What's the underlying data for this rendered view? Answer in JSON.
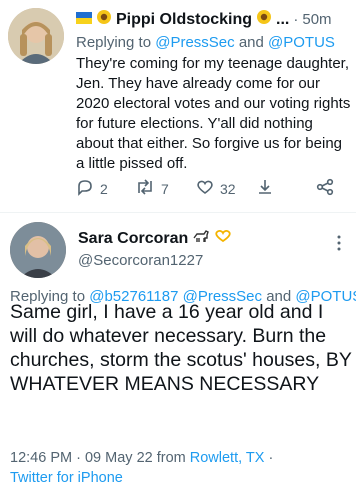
{
  "tweet1": {
    "display_name": "Pippi Oldstocking",
    "truncation": "...",
    "separator": "·",
    "time": "50m",
    "replying_prefix": "Replying to",
    "replying_handles": [
      "@PressSec",
      "@POTUS"
    ],
    "replying_joiner": "and",
    "body": "They're coming for my teenage daughter, Jen. They have already come for our 2020 electoral votes and our voting rights for future elections. Y'all did nothing about that either. So forgive us for being a little pissed off.",
    "replies": "2",
    "retweets": "7",
    "likes": "32",
    "icons": [
      "flag-icon",
      "sunflower-icon",
      "reply-icon",
      "retweet-icon",
      "like-icon",
      "share-icon",
      "more-icon"
    ]
  },
  "tweet2": {
    "display_name": "Sara Corcoran",
    "handle": "@Secorcoran1227",
    "replying_prefix": "Replying to",
    "replying_handles": [
      "@b52761187",
      "@PressSec",
      "@POTUS"
    ],
    "replying_joiner": "and",
    "body": "Same girl, I have a 16 year old and I will do whatever necessary. Burn the churches, storm the scotus' houses, BY WHATEVER MEANS NECESSARY",
    "time": "12:46 PM",
    "separator": "·",
    "date": "09 May 22",
    "from_prefix": "from",
    "location": "Rowlett, TX",
    "client": "Twitter for iPhone",
    "icons": [
      "donkey-icon",
      "heart-hands-icon",
      "more-icon"
    ]
  },
  "colors": {
    "link": "#1d9bf0",
    "muted": "#536471",
    "text": "#0f1419"
  }
}
